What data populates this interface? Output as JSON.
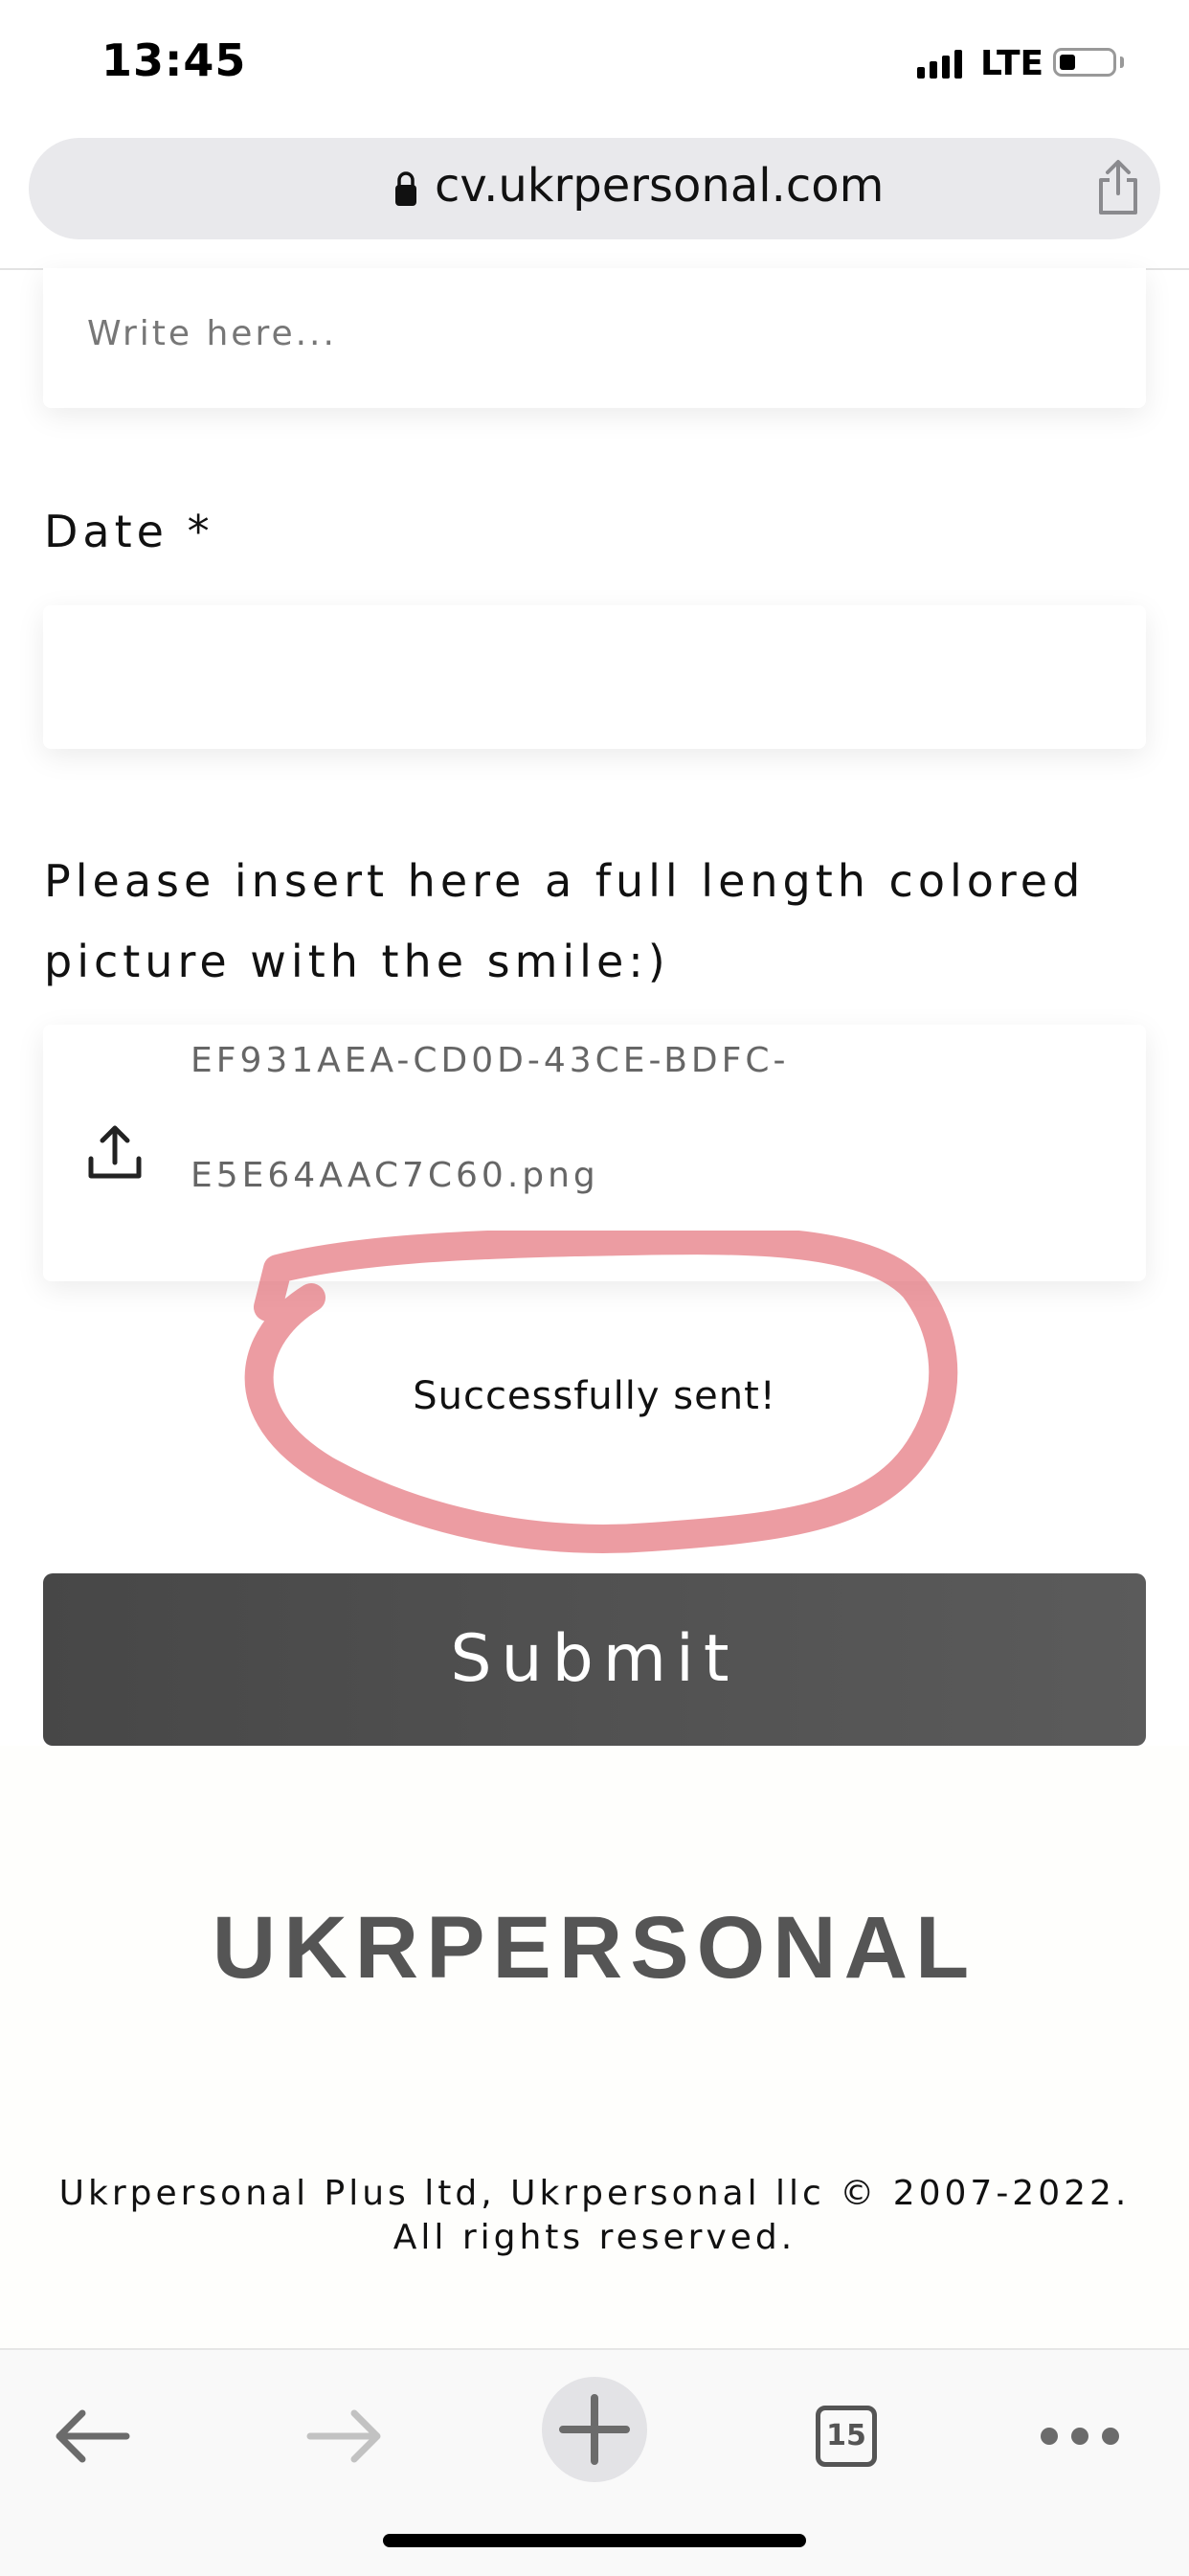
{
  "status_bar": {
    "time": "13:45",
    "network": "LTE"
  },
  "browser": {
    "url": "cv.ukrpersonal.com",
    "tab_count": "15"
  },
  "form": {
    "text_field": {
      "placeholder": "Write here..."
    },
    "date_field": {
      "label": "Date *",
      "value": ""
    },
    "photo_field": {
      "label": "Please insert here a full length colored picture with the smile:)",
      "file_name_line1": "EF931AEA-CD0D-43CE-BDFC-",
      "file_name_line2": "E5E64AAC7C60.png"
    },
    "status_message": "Successfully sent!",
    "submit_label": "Submit"
  },
  "footer": {
    "brand": "UKRPERSONAL",
    "copyright": "Ukrpersonal Plus ltd, Ukrpersonal llc © 2007-2022. All rights reserved."
  },
  "colors": {
    "annotation": "#e05a64",
    "submit_bg": "#4f4f4f",
    "brand_text": "#555555"
  },
  "icons": [
    "lock-icon",
    "share-icon",
    "upload-icon",
    "back-icon",
    "forward-icon",
    "plus-icon",
    "tabs-icon",
    "more-icon"
  ]
}
